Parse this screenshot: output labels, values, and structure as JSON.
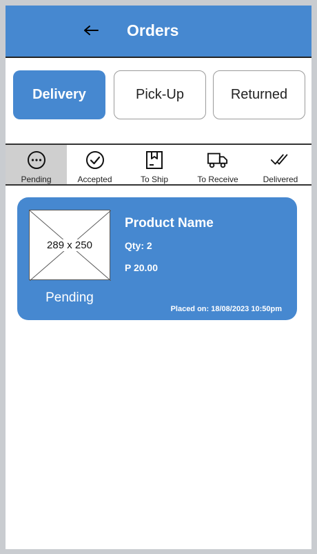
{
  "header": {
    "title": "Orders",
    "back_icon": "arrow-left-icon"
  },
  "segments": [
    {
      "label": "Delivery",
      "active": true
    },
    {
      "label": "Pick-Up",
      "active": false
    },
    {
      "label": "Returned",
      "active": false
    }
  ],
  "status_tabs": [
    {
      "label": "Pending",
      "icon": "ellipsis-circle-icon",
      "active": true
    },
    {
      "label": "Accepted",
      "icon": "check-circle-icon",
      "active": false
    },
    {
      "label": "To Ship",
      "icon": "package-icon",
      "active": false
    },
    {
      "label": "To Receive",
      "icon": "truck-icon",
      "active": false
    },
    {
      "label": "Delivered",
      "icon": "double-check-icon",
      "active": false
    }
  ],
  "orders": [
    {
      "image_placeholder": "289 x 250",
      "status": "Pending",
      "product_name": "Product Name",
      "qty": "Qty: 2",
      "price": "P 20.00",
      "placed_on": "Placed on: 18/08/2023 10:50pm"
    }
  ],
  "colors": {
    "primary": "#4688d0",
    "active_tab_bg": "#cfcfcf"
  }
}
